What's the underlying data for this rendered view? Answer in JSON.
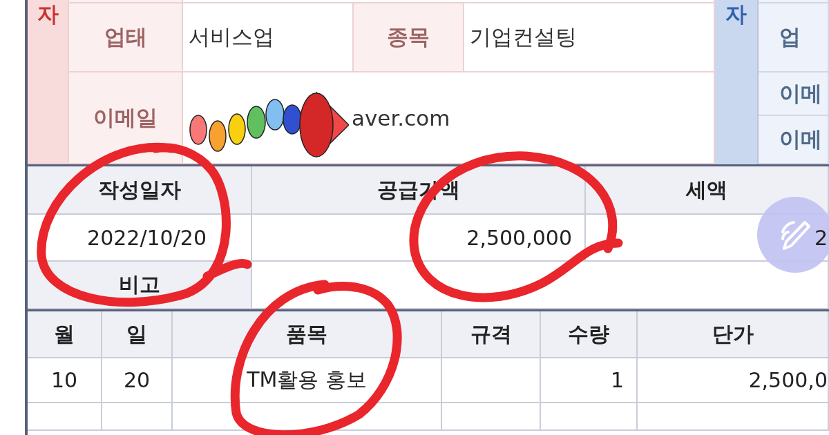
{
  "supplier": {
    "section_label": "자",
    "rows": [
      {
        "label": "업태",
        "value": "서비스업",
        "label_2": "종목",
        "value_2": "기업컨설팅"
      },
      {
        "label": "이메일",
        "value": "aver.com"
      }
    ]
  },
  "recipient": {
    "section_label": "자",
    "labels": [
      "업",
      "이메",
      "이메"
    ]
  },
  "summary": {
    "columns": [
      "작성일자",
      "공급가액",
      "세액"
    ],
    "values": [
      "2022/10/20",
      "2,500,000",
      "2"
    ],
    "note_label": "비고"
  },
  "items": {
    "columns": [
      "월",
      "일",
      "품목",
      "규격",
      "수량",
      "단가"
    ],
    "rows": [
      {
        "month": "10",
        "day": "20",
        "item": "TM활용 홍보",
        "quantity": "1",
        "unit_price": "2,500,0"
      }
    ]
  }
}
